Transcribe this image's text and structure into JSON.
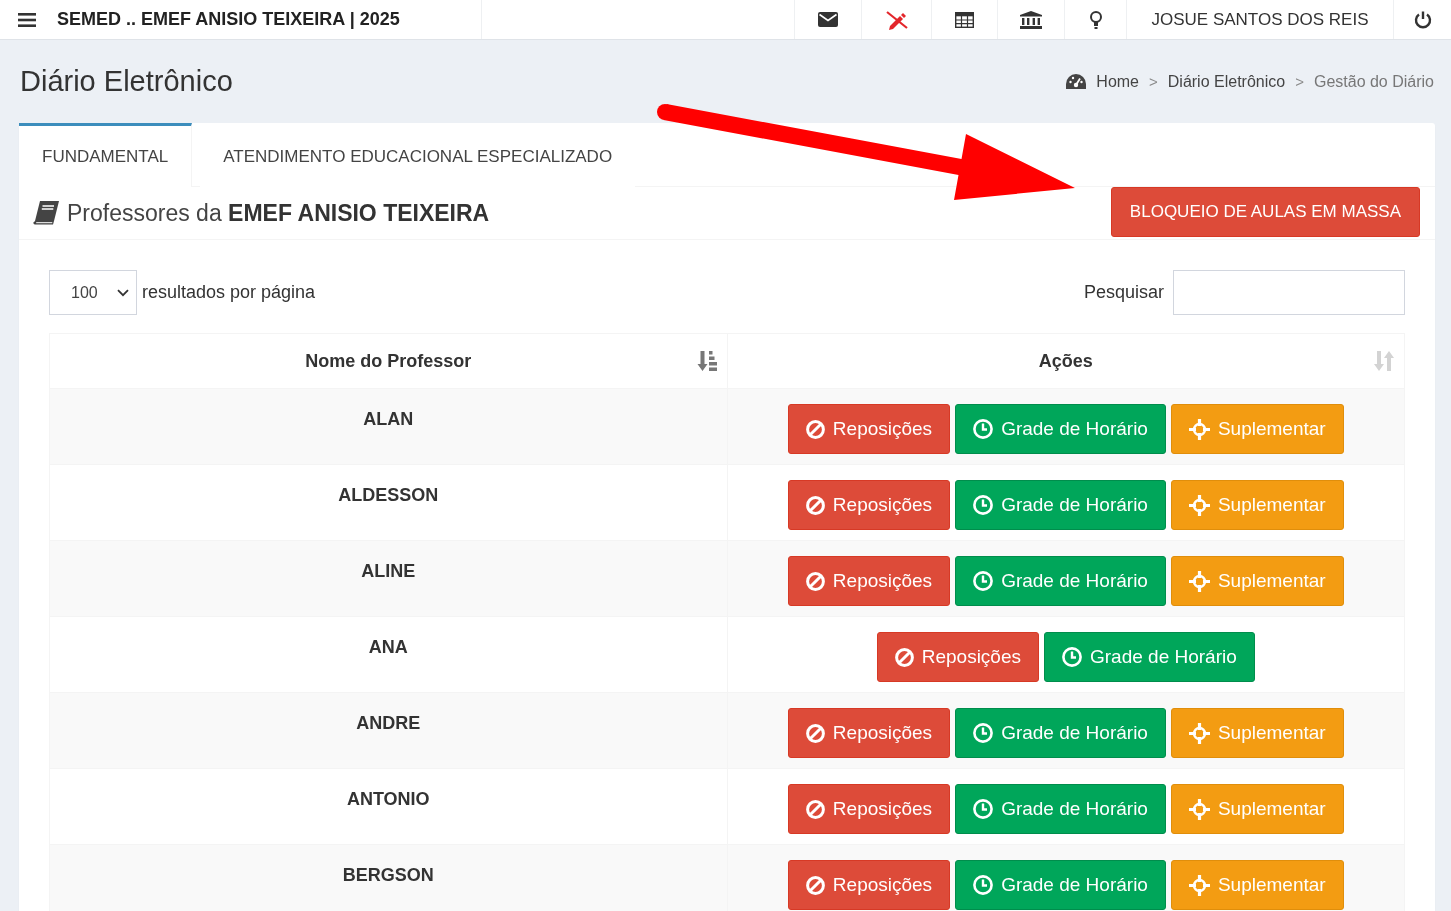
{
  "top_bar": {
    "title": "SEMED .. EMEF ANISIO TEIXEIRA | 2025",
    "user": "JOSUE SANTOS DOS REIS"
  },
  "page": {
    "title": "Diário Eletrônico",
    "breadcrumb": [
      {
        "label": "Home",
        "current": false
      },
      {
        "separator": ">",
        "label": "Diário Eletrônico",
        "current": false
      },
      {
        "separator": ">",
        "label": "Gestão do Diário",
        "current": true
      }
    ]
  },
  "tabs": [
    {
      "label": "FUNDAMENTAL",
      "selected": true
    },
    {
      "label": "ATENDIMENTO EDUCACIONAL ESPECIALIZADO",
      "selected": false
    }
  ],
  "box": {
    "title": "Professores da **EMEF ANISIO TEIXEIRA**",
    "action_button": "BLOQUEIO DE AULAS EM MASSA"
  },
  "table_controls": {
    "page_size": "100",
    "page_size_label": "resultados por página",
    "search_label": "Pesquisar"
  },
  "table": {
    "columns": [
      {
        "label": "Nome do Professor",
        "sorted": true
      },
      {
        "label": "Ações",
        "sorted": false
      }
    ],
    "rows": [
      {
        "name": "ALAN",
        "actions": [
          {
            "kind": "replacement",
            "label": "Reposições"
          },
          {
            "kind": "schedule",
            "label": "Grade de Horário"
          },
          {
            "kind": "supplement",
            "label": "Suplementar"
          }
        ]
      },
      {
        "name": "ALDESSON",
        "actions": [
          {
            "kind": "replacement",
            "label": "Reposições"
          },
          {
            "kind": "schedule",
            "label": "Grade de Horário"
          },
          {
            "kind": "supplement",
            "label": "Suplementar"
          }
        ]
      },
      {
        "name": "ALINE",
        "actions": [
          {
            "kind": "replacement",
            "label": "Reposições"
          },
          {
            "kind": "schedule",
            "label": "Grade de Horário"
          },
          {
            "kind": "supplement",
            "label": "Suplementar"
          }
        ]
      },
      {
        "name": "ANA",
        "actions": [
          {
            "kind": "replacement",
            "label": "Reposições"
          },
          {
            "kind": "schedule",
            "label": "Grade de Horário"
          }
        ]
      },
      {
        "name": "ANDRE",
        "actions": [
          {
            "kind": "replacement",
            "label": "Reposições"
          },
          {
            "kind": "schedule",
            "label": "Grade de Horário"
          },
          {
            "kind": "supplement",
            "label": "Suplementar"
          }
        ]
      },
      {
        "name": "ANTONIO",
        "actions": [
          {
            "kind": "replacement",
            "label": "Reposições"
          },
          {
            "kind": "schedule",
            "label": "Grade de Horário"
          },
          {
            "kind": "supplement",
            "label": "Suplementar"
          }
        ]
      },
      {
        "name": "BERGSON",
        "actions": [
          {
            "kind": "replacement",
            "label": "Reposições"
          },
          {
            "kind": "schedule",
            "label": "Grade de Horário"
          },
          {
            "kind": "supplement",
            "label": "Suplementar"
          }
        ]
      }
    ]
  },
  "annotations": [
    {
      "kind": "arrow"
    }
  ]
}
